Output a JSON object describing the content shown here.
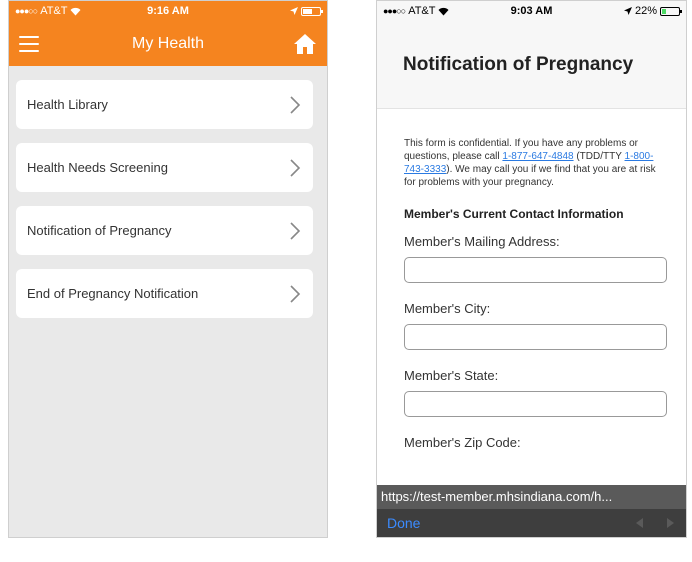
{
  "left": {
    "status": {
      "carrier": "AT&T",
      "time": "9:16 AM"
    },
    "nav": {
      "title": "My Health"
    },
    "menu": [
      {
        "label": "Health Library"
      },
      {
        "label": "Health Needs Screening"
      },
      {
        "label": "Notification of Pregnancy"
      },
      {
        "label": "End of Pregnancy Notification"
      }
    ]
  },
  "right": {
    "status": {
      "carrier": "AT&T",
      "time": "9:03 AM",
      "battery": "22%"
    },
    "form": {
      "title": "Notification of Pregnancy",
      "intro_1": "This form is confidential. If you have any problems or questions, please call ",
      "phone": "1-877-647-4848",
      "intro_2": " (TDD/TTY ",
      "tty": "1-800-743-3333",
      "intro_3": "). We may call you if we find that you are at risk for problems with your pregnancy.",
      "section": "Member's Current Contact Information",
      "fields": [
        {
          "label": "Member's Mailing Address:"
        },
        {
          "label": "Member's City:"
        },
        {
          "label": "Member's State:"
        },
        {
          "label": "Member's Zip Code:"
        }
      ]
    },
    "url": "https://test-member.mhsindiana.com/h...",
    "toolbar": {
      "done": "Done"
    }
  },
  "colors": {
    "accent": "#f5841f",
    "link": "#2a7ae2"
  }
}
